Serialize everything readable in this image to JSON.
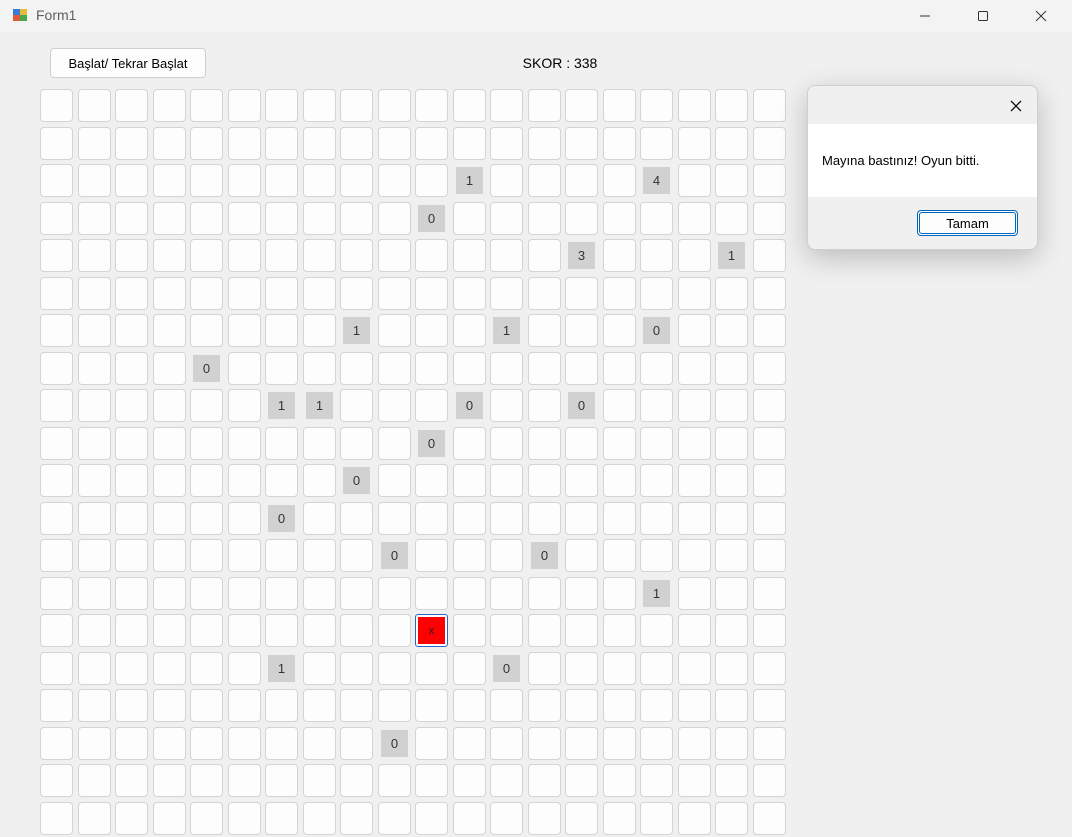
{
  "window": {
    "title": "Form1",
    "icon": "winforms-app-icon",
    "controls": [
      "minimize-icon",
      "maximize-icon",
      "close-icon"
    ]
  },
  "toolbar": {
    "restart_label": "Başlat/ Tekrar Başlat",
    "score_text": "SKOR : 338"
  },
  "board": {
    "rows": 20,
    "cols": 20,
    "revealed": [
      {
        "r": 2,
        "c": 11,
        "v": "1"
      },
      {
        "r": 2,
        "c": 16,
        "v": "4"
      },
      {
        "r": 3,
        "c": 10,
        "v": "0"
      },
      {
        "r": 4,
        "c": 14,
        "v": "3"
      },
      {
        "r": 4,
        "c": 18,
        "v": "1"
      },
      {
        "r": 6,
        "c": 8,
        "v": "1"
      },
      {
        "r": 6,
        "c": 12,
        "v": "1"
      },
      {
        "r": 6,
        "c": 16,
        "v": "0"
      },
      {
        "r": 7,
        "c": 4,
        "v": "0"
      },
      {
        "r": 8,
        "c": 6,
        "v": "1"
      },
      {
        "r": 8,
        "c": 7,
        "v": "1"
      },
      {
        "r": 8,
        "c": 11,
        "v": "0"
      },
      {
        "r": 8,
        "c": 14,
        "v": "0"
      },
      {
        "r": 9,
        "c": 10,
        "v": "0"
      },
      {
        "r": 10,
        "c": 8,
        "v": "0"
      },
      {
        "r": 11,
        "c": 6,
        "v": "0"
      },
      {
        "r": 12,
        "c": 9,
        "v": "0"
      },
      {
        "r": 12,
        "c": 13,
        "v": "0"
      },
      {
        "r": 13,
        "c": 16,
        "v": "1"
      },
      {
        "r": 15,
        "c": 6,
        "v": "1"
      },
      {
        "r": 15,
        "c": 12,
        "v": "0"
      },
      {
        "r": 17,
        "c": 9,
        "v": "0"
      }
    ],
    "mine": {
      "r": 14,
      "c": 10,
      "v": "x"
    },
    "colors": {
      "mine": "#ff0000",
      "revealed": "#d1d1d1",
      "hidden": "#fdfdfd"
    }
  },
  "dialog": {
    "message": "Mayına bastınız! Oyun bitti.",
    "ok_label": "Tamam"
  }
}
